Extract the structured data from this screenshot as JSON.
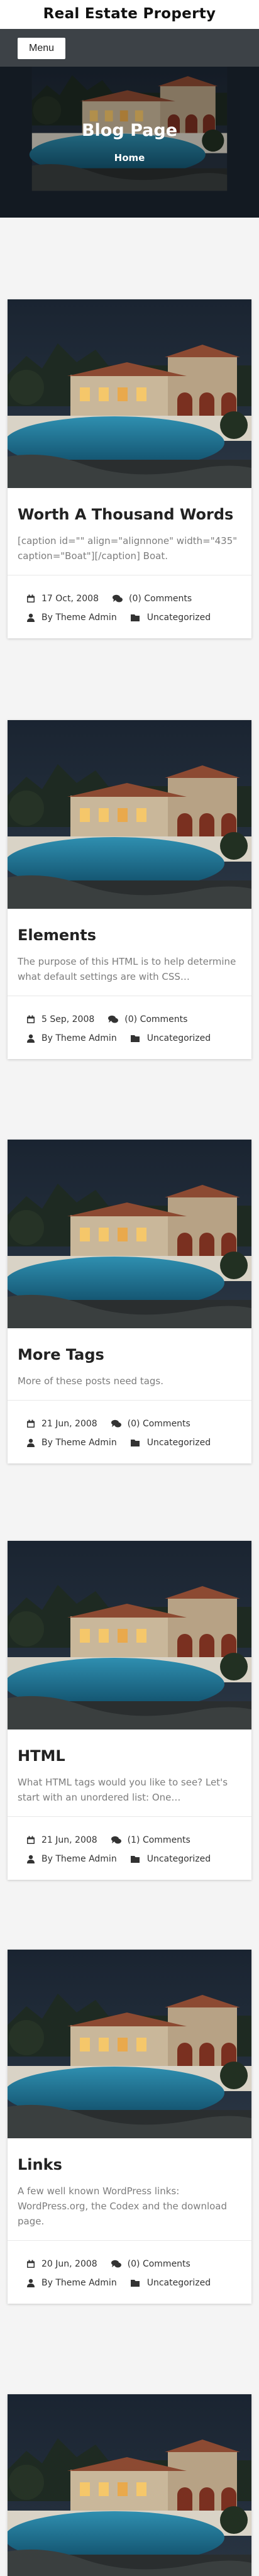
{
  "site": {
    "title": "Real Estate Property"
  },
  "nav": {
    "menu_label": "Menu"
  },
  "hero": {
    "title": "Blog Page",
    "breadcrumb": "Home"
  },
  "posts": [
    {
      "title": "Worth A Thousand Words",
      "excerpt": "[caption id=\"\" align=\"alignnone\" width=\"435\" caption=\"Boat\"][/caption] Boat.",
      "date": "17 Oct, 2008",
      "comments": "(0) Comments",
      "author": "By Theme Admin",
      "category": "Uncategorized"
    },
    {
      "title": "Elements",
      "excerpt": "The purpose of this HTML is to help determine what default settings are with CSS…",
      "date": "5 Sep, 2008",
      "comments": "(0) Comments",
      "author": "By Theme Admin",
      "category": "Uncategorized"
    },
    {
      "title": "More Tags",
      "excerpt": "More of these posts need tags.",
      "date": "21 Jun, 2008",
      "comments": "(0) Comments",
      "author": "By Theme Admin",
      "category": "Uncategorized"
    },
    {
      "title": "HTML",
      "excerpt": "What HTML tags would you like to see? Let's start with an unordered list: One…",
      "date": "21 Jun, 2008",
      "comments": "(1) Comments",
      "author": "By Theme Admin",
      "category": "Uncategorized"
    },
    {
      "title": "Links",
      "excerpt": "A few well known WordPress links: WordPress.org, the Codex and the download page.",
      "date": "20 Jun, 2008",
      "comments": "(0) Comments",
      "author": "By Theme Admin",
      "category": "Uncategorized"
    }
  ],
  "colors": {
    "menu_bar": "#3d4247",
    "page_bg": "#f4f4f4",
    "excerpt": "#7d7d7d"
  }
}
